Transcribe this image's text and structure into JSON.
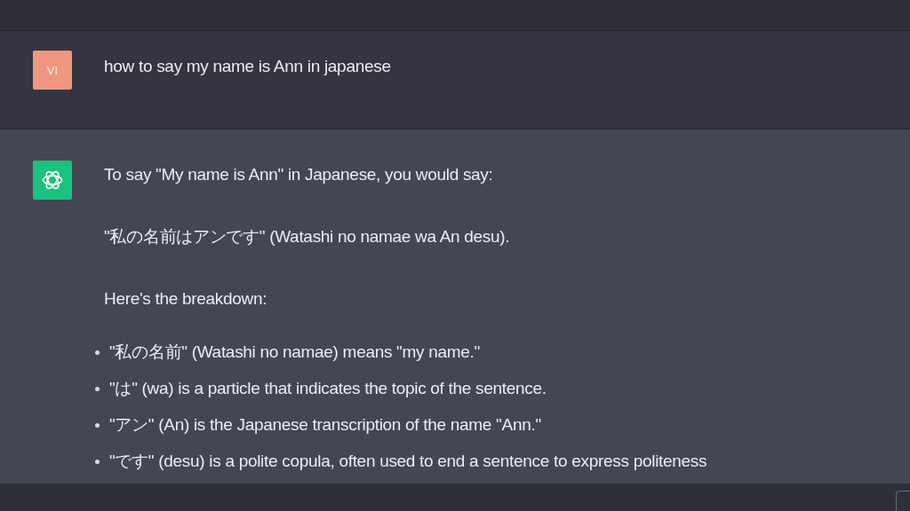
{
  "conversation": [
    {
      "kind": "user",
      "avatar": "VI",
      "paragraphs": [
        "how to say my name is Ann in japanese"
      ]
    },
    {
      "kind": "assistant",
      "paragraphs": [
        "To say \"My name is Ann\" in Japanese, you would say:",
        "\"私の名前はアンです\" (Watashi no namae wa An desu).",
        "Here's the breakdown:"
      ],
      "bullets": [
        "\"私の名前\" (Watashi no namae) means \"my name.\"",
        "\"は\" (wa) is a particle that indicates the topic of the sentence.",
        "\"アン\" (An) is the Japanese transcription of the name \"Ann.\"",
        "\"です\" (desu) is a polite copula, often used to end a sentence to express politeness"
      ]
    }
  ]
}
